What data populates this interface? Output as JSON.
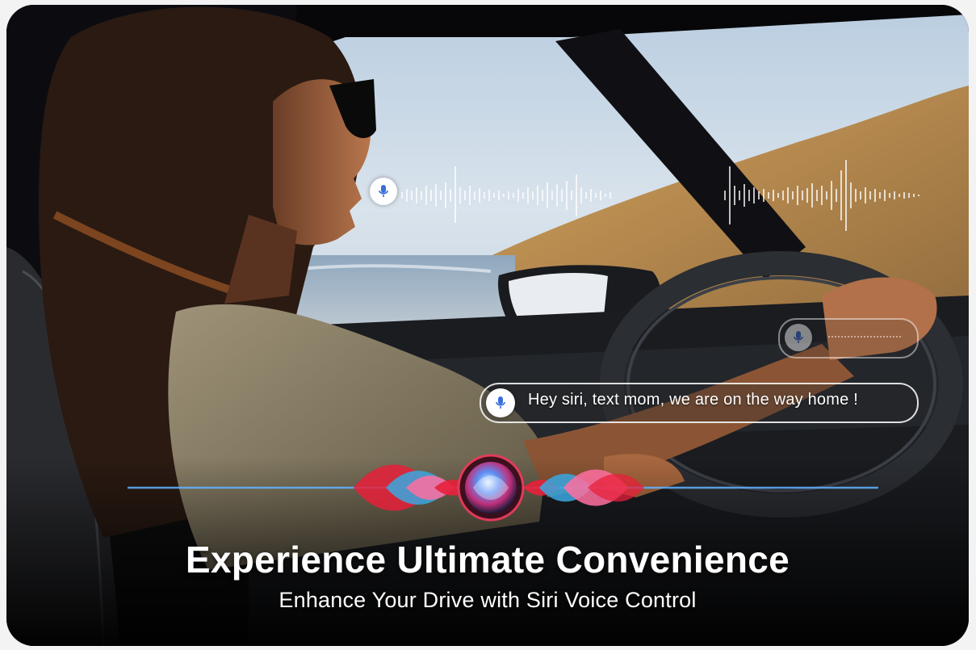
{
  "voice_command": {
    "text": "Hey siri, text mom, we are on the way home !",
    "icon": "microphone-icon"
  },
  "top_waveform": {
    "icon": "microphone-icon"
  },
  "faded_pill": {
    "icon": "microphone-icon"
  },
  "siri": {
    "icon": "siri-orb-icon",
    "wave_colors": [
      "#e8203a",
      "#3aa7e0",
      "#ff6fa0",
      "#1f6fd8"
    ]
  },
  "headline": "Experience Ultimate Convenience",
  "subheadline": "Enhance Your Drive with Siri Voice Control"
}
